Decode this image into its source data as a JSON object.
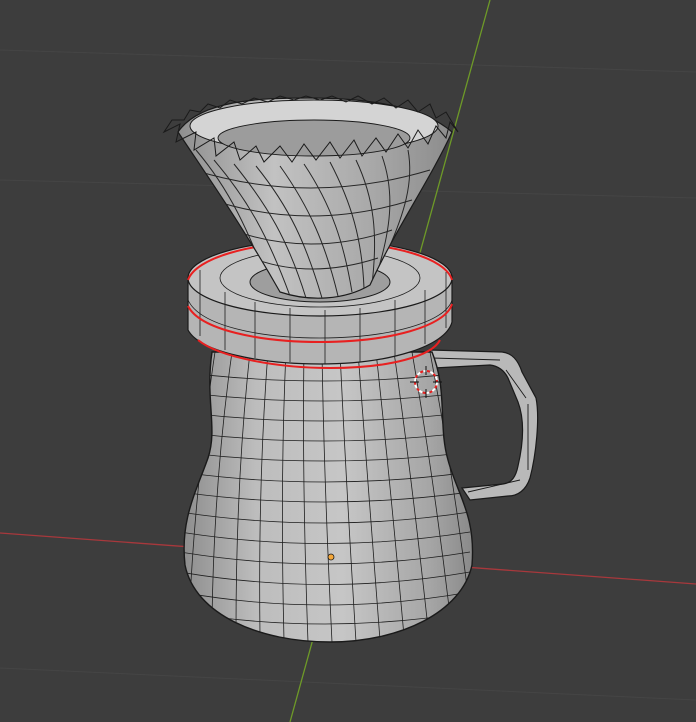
{
  "viewport": {
    "background": "#3d3d3d",
    "grid_color": "#444444",
    "x_axis_color": "#a8383c",
    "y_axis_color": "#6e9a28"
  },
  "model": {
    "fill": "#b3b3b3",
    "fill_dark": "#8a8a8a",
    "fill_light": "#cfcfcf",
    "wire": "#1a1a1a",
    "selection": "#e82020",
    "origin": "#f4a73a"
  },
  "icons": {
    "cursor": "3d-cursor-icon",
    "origin": "object-origin-icon"
  }
}
